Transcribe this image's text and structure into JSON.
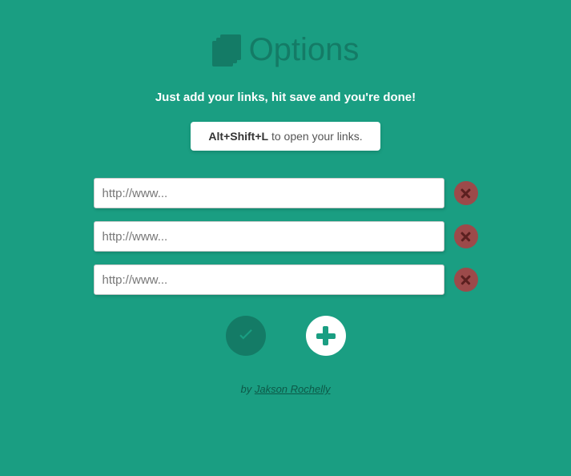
{
  "title": "Options",
  "subtitle": "Just add your links, hit save and you're done!",
  "shortcut": {
    "keys": "Alt+Shift+L",
    "rest": " to open your links."
  },
  "links": [
    {
      "placeholder": "http://www...",
      "value": ""
    },
    {
      "placeholder": "http://www...",
      "value": ""
    },
    {
      "placeholder": "http://www...",
      "value": ""
    }
  ],
  "footer": {
    "by": "by ",
    "author": "Jakson Rochelly"
  }
}
